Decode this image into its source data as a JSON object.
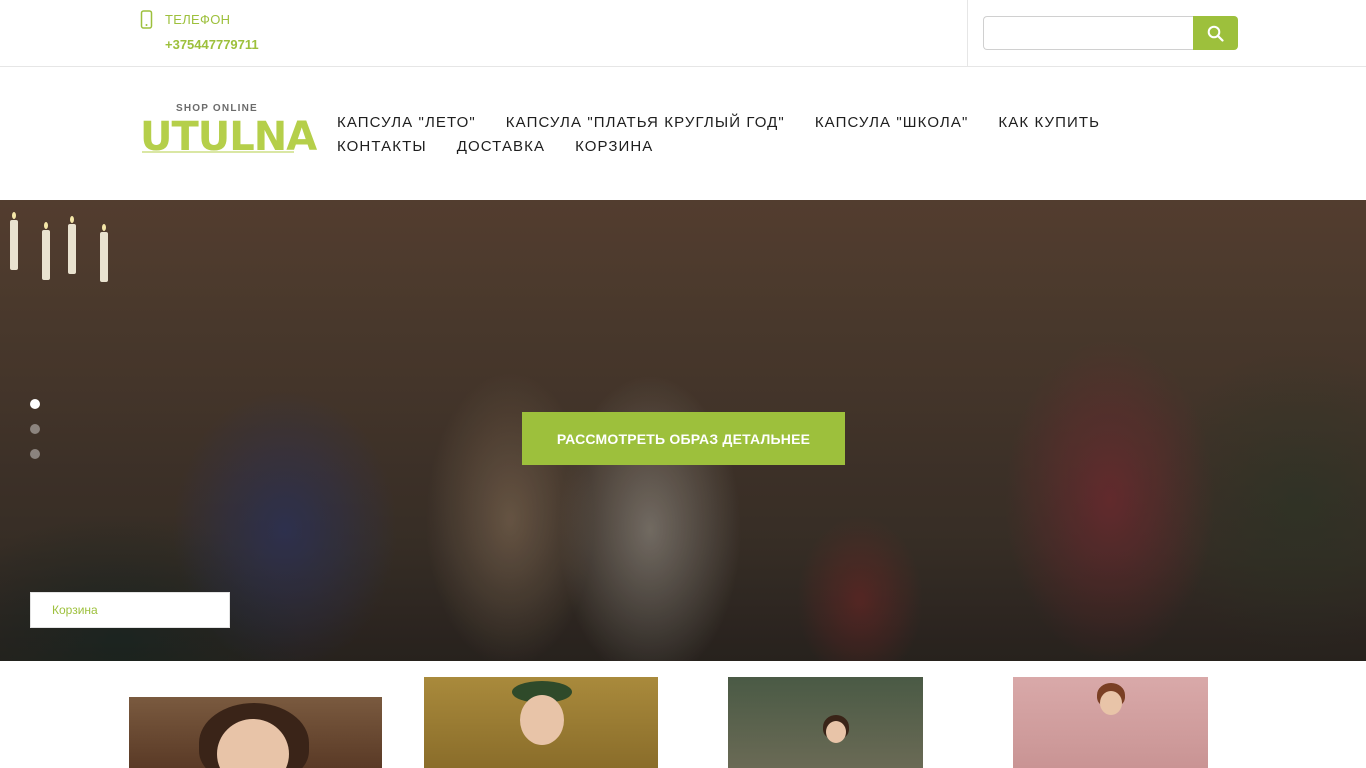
{
  "topbar": {
    "phone_label": "ТЕЛЕФОН",
    "phone_number": "+375447779711",
    "phone_icon": "mobile-phone-icon",
    "search": {
      "value": "",
      "placeholder": "",
      "button_icon": "search-icon"
    }
  },
  "logo": {
    "tagline": "SHOP ONLINE",
    "name": "UTULNA"
  },
  "nav": {
    "items": [
      {
        "label": "КАПСУЛА \"ЛЕТО\""
      },
      {
        "label": "КАПСУЛА \"ПЛАТЬЯ КРУГЛЫЙ ГОД\""
      },
      {
        "label": "КАПСУЛА \"ШКОЛА\""
      },
      {
        "label": "КАК КУПИТЬ"
      },
      {
        "label": "КОНТАКТЫ"
      },
      {
        "label": "ДОСТАВКА"
      },
      {
        "label": "КОРЗИНА"
      }
    ]
  },
  "hero": {
    "cta_label": "РАССМОТРЕТЬ ОБРАЗ ДЕТАЛЬНЕЕ",
    "slide_count": 3,
    "active_slide": 1,
    "cart_label": "Корзина"
  },
  "colors": {
    "accent": "#9dc03c",
    "text": "#1e1e1e",
    "border": "#e6e6e6"
  },
  "products": {
    "count_visible": 4
  }
}
